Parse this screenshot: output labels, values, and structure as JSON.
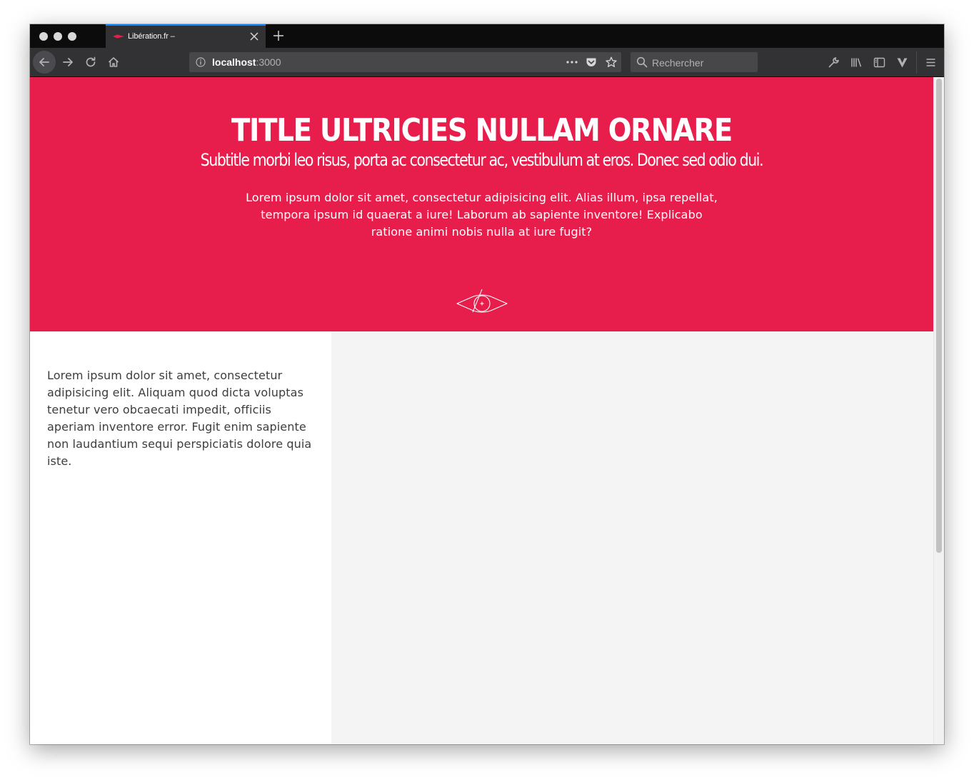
{
  "browser": {
    "tab_title": "Libération.fr –",
    "url_host": "localhost",
    "url_port": ":3000",
    "search_placeholder": "Rechercher",
    "icons": {
      "back": "back-arrow-icon",
      "forward": "forward-arrow-icon",
      "reload": "reload-icon",
      "home": "home-icon",
      "info": "info-icon",
      "more": "more-dots-icon",
      "pocket": "pocket-icon",
      "bookmark": "star-icon",
      "search": "search-icon",
      "devtools": "wrench-icon",
      "library": "library-icon",
      "sidebar": "sidebar-icon",
      "extension": "v-extension-icon",
      "menu": "hamburger-menu-icon"
    }
  },
  "hero": {
    "title": "TITLE ULTRICIES NULLAM ORNARE",
    "subtitle": "Subtitle morbi leo risus, porta ac consectetur ac, vestibulum at eros. Donec sed odio dui.",
    "body": "Lorem ipsum dolor sit amet, consectetur adipisicing elit. Alias illum, ipsa repellat, tempora ipsum id quaerat a iure! Laborum ab sapiente inventore! Explicabo ratione animi nobis nulla at iure fugit?",
    "background_color": "#e71d4b",
    "logo": "liberation-eye-logo"
  },
  "content": {
    "left_text": "Lorem ipsum dolor sit amet, consectetur adipisicing elit. Aliquam quod dicta voluptas tenetur vero obcaecati impedit, officiis aperiam inventore error. Fugit enim sapiente non laudantium sequi perspiciatis dolore quia iste.",
    "right_background": "#f4f4f4"
  }
}
